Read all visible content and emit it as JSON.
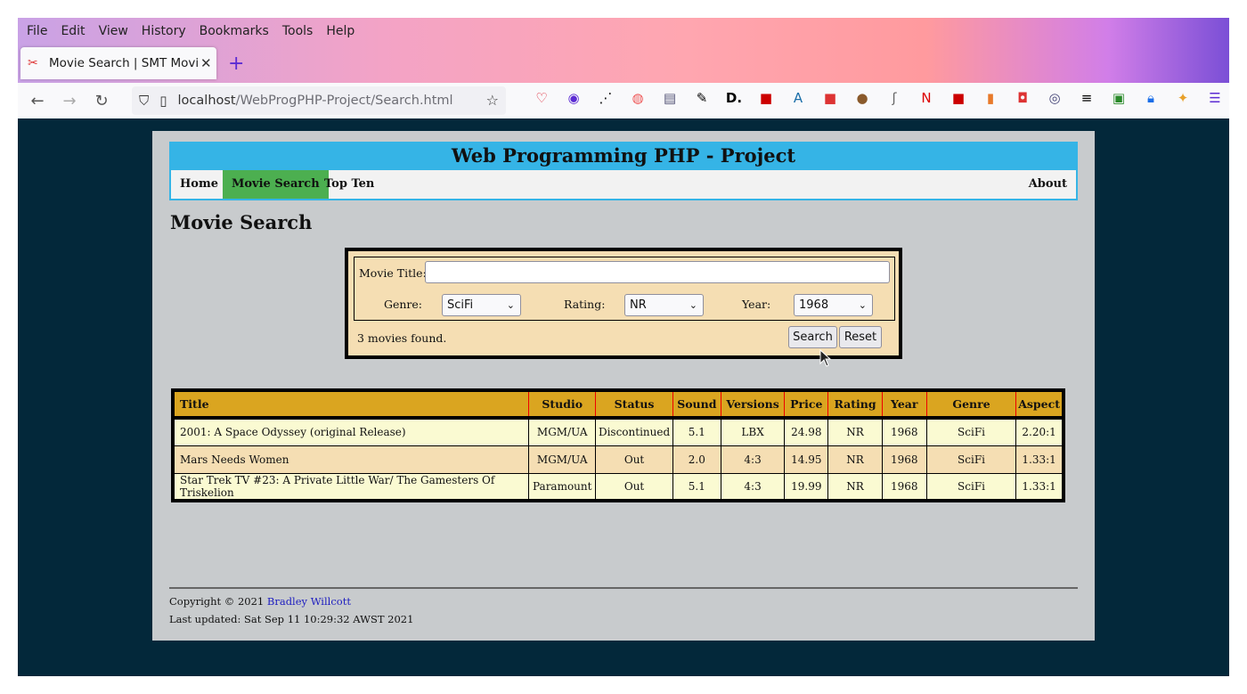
{
  "browser": {
    "menu": [
      "File",
      "Edit",
      "View",
      "History",
      "Bookmarks",
      "Tools",
      "Help"
    ],
    "tab_title": "Movie Search | SMT Movie",
    "url_host": "localhost",
    "url_path": "/WebProgPHP-Project/Search.html"
  },
  "site": {
    "banner": "Web Programming PHP - Project",
    "nav": {
      "home": "Home",
      "search": "Movie Search",
      "topten": "Top Ten",
      "about": "About"
    },
    "heading": "Movie Search"
  },
  "form": {
    "title_label": "Movie Title:",
    "title_value": "",
    "genre_label": "Genre:",
    "genre_value": "SciFi",
    "rating_label": "Rating:",
    "rating_value": "NR",
    "year_label": "Year:",
    "year_value": "1968",
    "found_text": "3 movies found.",
    "search_label": "Search",
    "reset_label": "Reset"
  },
  "table": {
    "headers": [
      "Title",
      "Studio",
      "Status",
      "Sound",
      "Versions",
      "Price",
      "Rating",
      "Year",
      "Genre",
      "Aspect"
    ],
    "rows": [
      [
        "2001: A Space Odyssey (original Release)",
        "MGM/UA",
        "Discontinued",
        "5.1",
        "LBX",
        "24.98",
        "NR",
        "1968",
        "SciFi",
        "2.20:1"
      ],
      [
        "Mars Needs Women",
        "MGM/UA",
        "Out",
        "2.0",
        "4:3",
        "14.95",
        "NR",
        "1968",
        "SciFi",
        "1.33:1"
      ],
      [
        "Star Trek TV #23: A Private Little War/ The Gamesters Of Triskelion",
        "Paramount",
        "Out",
        "5.1",
        "4:3",
        "19.99",
        "NR",
        "1968",
        "SciFi",
        "1.33:1"
      ]
    ]
  },
  "footer": {
    "copyright": "Copyright © 2021",
    "author": "Bradley Willcott",
    "updated": "Last updated: Sat Sep 11 10:29:32 AWST 2021"
  }
}
